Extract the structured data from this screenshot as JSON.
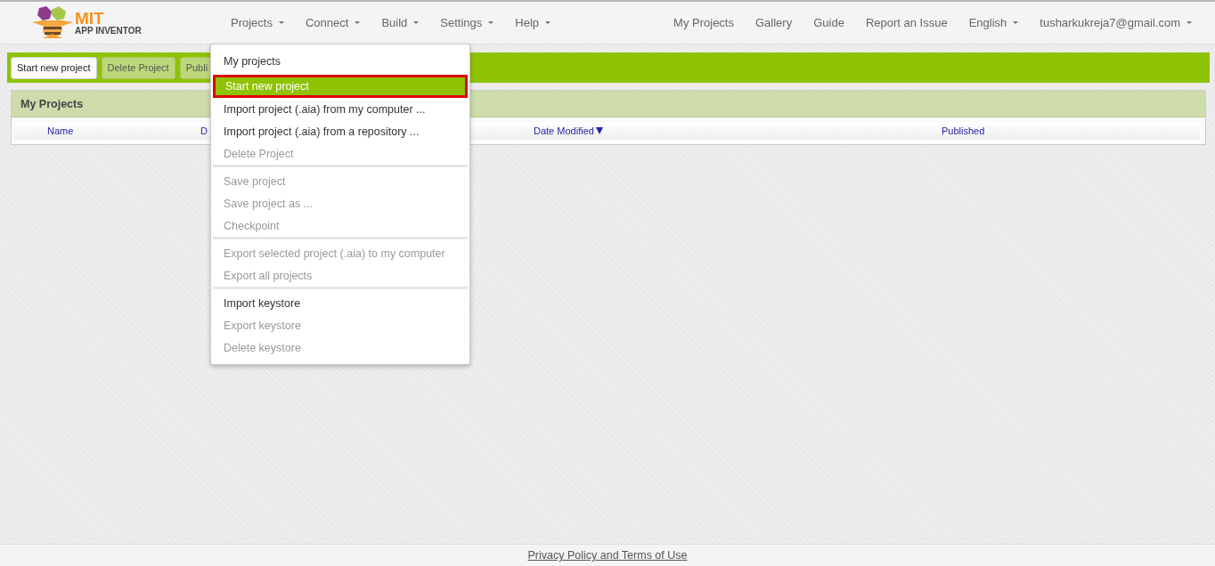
{
  "logo": {
    "title": "MIT",
    "subtitle": "APP INVENTOR"
  },
  "nav_menu": [
    {
      "label": "Projects",
      "dropdown": true
    },
    {
      "label": "Connect",
      "dropdown": true
    },
    {
      "label": "Build",
      "dropdown": true
    },
    {
      "label": "Settings",
      "dropdown": true
    },
    {
      "label": "Help",
      "dropdown": true
    }
  ],
  "nav_links": [
    {
      "label": "My Projects",
      "dropdown": false
    },
    {
      "label": "Gallery",
      "dropdown": false
    },
    {
      "label": "Guide",
      "dropdown": false
    },
    {
      "label": "Report an Issue",
      "dropdown": false
    },
    {
      "label": "English",
      "dropdown": true
    },
    {
      "label": "tusharkukreja7@gmail.com",
      "dropdown": true
    }
  ],
  "toolbar": [
    {
      "label": "Start new project",
      "disabled": false
    },
    {
      "label": "Delete Project",
      "disabled": true
    },
    {
      "label": "Publi",
      "disabled": true
    }
  ],
  "projects_panel": {
    "title": "My Projects",
    "columns": [
      {
        "label": "Name",
        "sorted": false
      },
      {
        "label": "D",
        "sorted": false
      },
      {
        "label": "Date Modified",
        "sorted": true
      },
      {
        "label": "Published",
        "sorted": false
      }
    ]
  },
  "projects_menu": [
    [
      {
        "label": "My projects",
        "disabled": false,
        "selected": false
      },
      {
        "label": "Start new project",
        "disabled": false,
        "selected": true
      },
      {
        "label": "Import project (.aia) from my computer ...",
        "disabled": false,
        "selected": false
      },
      {
        "label": "Import project (.aia) from a repository ...",
        "disabled": false,
        "selected": false
      },
      {
        "label": "Delete Project",
        "disabled": true,
        "selected": false
      }
    ],
    [
      {
        "label": "Save project",
        "disabled": true,
        "selected": false
      },
      {
        "label": "Save project as ...",
        "disabled": true,
        "selected": false
      },
      {
        "label": "Checkpoint",
        "disabled": true,
        "selected": false
      }
    ],
    [
      {
        "label": "Export selected project (.aia) to my computer",
        "disabled": true,
        "selected": false
      },
      {
        "label": "Export all projects",
        "disabled": true,
        "selected": false
      }
    ],
    [
      {
        "label": "Import keystore",
        "disabled": false,
        "selected": false
      },
      {
        "label": "Export keystore",
        "disabled": true,
        "selected": false
      },
      {
        "label": "Delete keystore",
        "disabled": true,
        "selected": false
      }
    ]
  ],
  "footer": {
    "link": "Privacy Policy and Terms of Use"
  }
}
